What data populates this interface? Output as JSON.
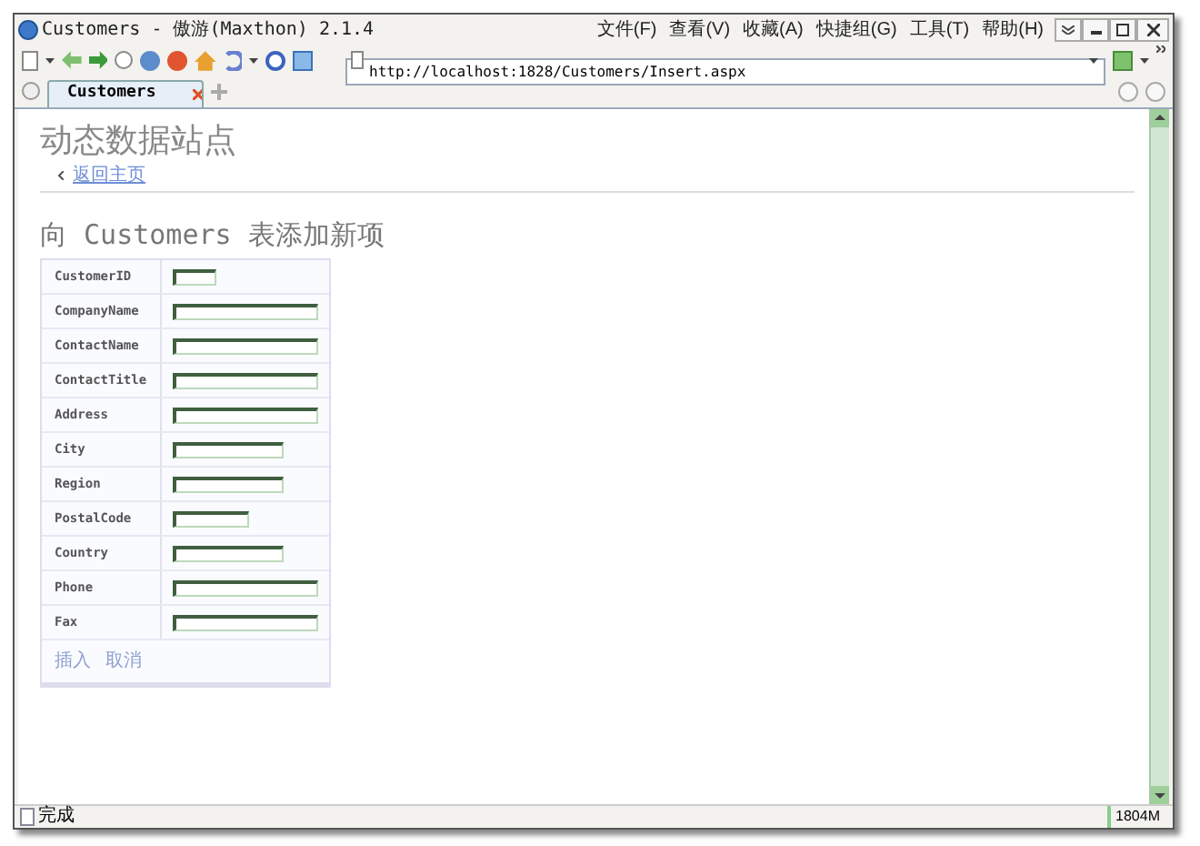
{
  "window": {
    "title": "Customers - 傲游(Maxthon) 2.1.4"
  },
  "menu": [
    "文件(F)",
    "查看(V)",
    "收藏(A)",
    "快捷组(G)",
    "工具(T)",
    "帮助(H)"
  ],
  "address": {
    "value": "http://localhost:1828/Customers/Insert.aspx"
  },
  "tabs": [
    {
      "label": "Customers",
      "selected": true
    }
  ],
  "page": {
    "site_title": "动态数据站点",
    "back_link": "返回主页",
    "heading": "向 Customers 表添加新项",
    "fields": [
      {
        "label": "CustomerID",
        "kind": "tiny"
      },
      {
        "label": "CompanyName",
        "kind": "long"
      },
      {
        "label": "ContactName",
        "kind": "long"
      },
      {
        "label": "ContactTitle",
        "kind": "long"
      },
      {
        "label": "Address",
        "kind": "long"
      },
      {
        "label": "City",
        "kind": "medium"
      },
      {
        "label": "Region",
        "kind": "medium"
      },
      {
        "label": "PostalCode",
        "kind": "short"
      },
      {
        "label": "Country",
        "kind": "medium"
      },
      {
        "label": "Phone",
        "kind": "long"
      },
      {
        "label": "Fax",
        "kind": "long"
      }
    ],
    "actions": [
      "插入",
      "取消"
    ]
  },
  "status_bar": {
    "text": "完成",
    "memory": "1804M"
  }
}
